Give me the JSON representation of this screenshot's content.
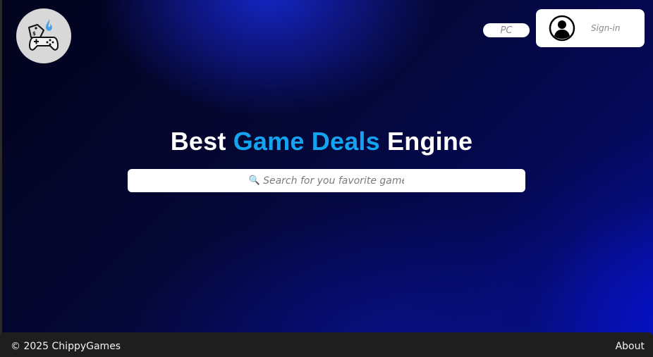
{
  "header": {
    "platform_label": "PC",
    "signin_label": "Sign-in"
  },
  "hero": {
    "title_part1": "Best ",
    "title_accent": "Game Deals",
    "title_part2": " Engine"
  },
  "search": {
    "icon": "magnifying-glass-icon",
    "placeholder": "Search for you favorite game",
    "value": ""
  },
  "footer": {
    "copyright": "© 2025 ChippyGames",
    "about_label": "About"
  },
  "colors": {
    "accent": "#14a3f0",
    "background_dark": "#02031c",
    "background_blue": "#0512d4",
    "footer_bg": "#1e1e1e"
  }
}
